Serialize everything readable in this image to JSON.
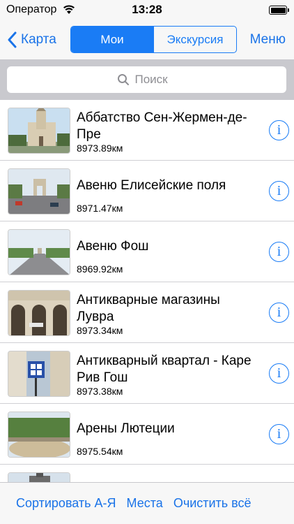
{
  "status_bar": {
    "carrier": "Оператор",
    "time": "13:28",
    "battery_level": 1.0
  },
  "nav": {
    "back_label": "Карта",
    "segments": [
      "Мои",
      "Экскурсия"
    ],
    "selected_segment": 0,
    "menu_label": "Меню"
  },
  "search": {
    "placeholder": "Поиск",
    "value": ""
  },
  "places": [
    {
      "title": "Аббатство Сен-Жермен-де-Пре",
      "distance": "8973.89км",
      "thumb_icon": "church-photo"
    },
    {
      "title": "Авеню Елисейские поля",
      "distance": "8971.47км",
      "thumb_icon": "arc-de-triomphe-photo"
    },
    {
      "title": "Авеню Фош",
      "distance": "8969.92км",
      "thumb_icon": "avenue-photo"
    },
    {
      "title": "Антикварные магазины Лувра",
      "distance": "8973.34км",
      "thumb_icon": "arcade-building-photo"
    },
    {
      "title": "Антикварный квартал - Каре Рив Гош",
      "distance": "8973.38км",
      "thumb_icon": "street-sign-photo"
    },
    {
      "title": "Арены Лютеции",
      "distance": "8975.54км",
      "thumb_icon": "arena-park-photo"
    },
    {
      "title": "",
      "distance": "",
      "thumb_icon": "monument-photo"
    }
  ],
  "toolbar": {
    "sort_label": "Сортировать А-Я",
    "places_label": "Места",
    "clear_label": "Очистить всё"
  },
  "colors": {
    "accent": "#1a7cf5",
    "bar_background": "#f7f7f7",
    "search_background": "#c9c9ce"
  }
}
